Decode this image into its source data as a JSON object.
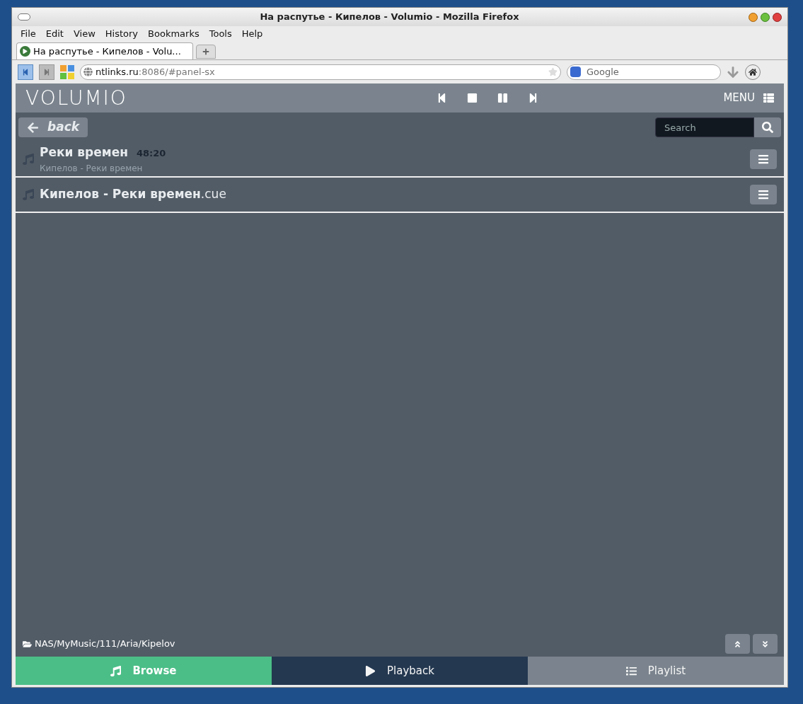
{
  "window": {
    "title": "На распутье - Кипелов - Volumio - Mozilla Firefox"
  },
  "menu": [
    "File",
    "Edit",
    "View",
    "History",
    "Bookmarks",
    "Tools",
    "Help"
  ],
  "tabs": [
    {
      "label": "На распутье - Кипелов - Volu...",
      "selected": true
    }
  ],
  "address": {
    "host": "ntlinks.ru",
    "rest": ":8086/#panel-sx"
  },
  "web_search": {
    "placeholder": "Google"
  },
  "app": {
    "logo": "VOLUMIO",
    "menu_label": "MENU",
    "back_label": "back",
    "search_placeholder": "Search",
    "rows": [
      {
        "kind": "track",
        "title": "Реки времен",
        "duration": "48:20",
        "subtitle": "Кипелов - Реки времен"
      },
      {
        "kind": "file",
        "title": "**Кипелов - Реки времен**.cue"
      }
    ],
    "path": "NAS/MyMusic/111/Aria/Kipelov",
    "bottom_tabs": [
      {
        "label": "Browse",
        "color": "#4bbe87",
        "selected": true
      },
      {
        "label": "Playback",
        "color": "#243850",
        "selected": false
      },
      {
        "label": "Playlist",
        "color": "#7b848e",
        "selected": false
      }
    ]
  }
}
